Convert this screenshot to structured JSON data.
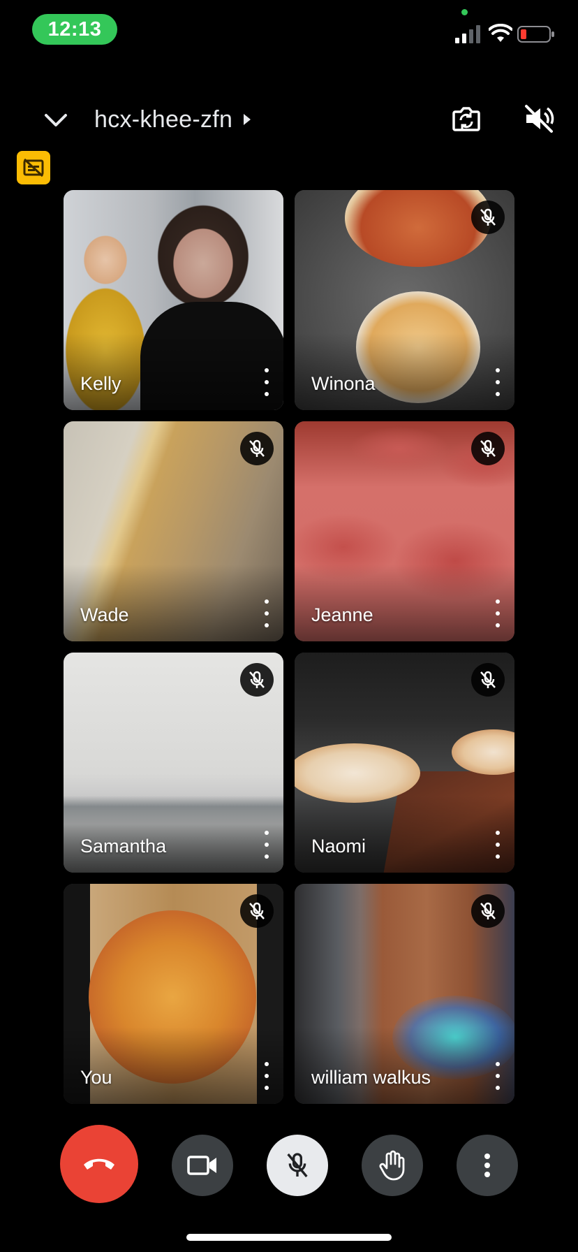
{
  "status_bar": {
    "time": "12:13",
    "icons": [
      "cellular-signal-icon",
      "wifi-icon",
      "battery-low-icon"
    ]
  },
  "header": {
    "meeting_code": "hcx-khee-zfn",
    "icons": [
      "chevron-down-icon",
      "caret-right-icon",
      "flip-camera-icon",
      "speaker-off-icon",
      "captions-off-icon"
    ]
  },
  "participants": [
    {
      "name": "Kelly",
      "muted": false
    },
    {
      "name": "Winona",
      "muted": true
    },
    {
      "name": "Wade",
      "muted": true
    },
    {
      "name": "Jeanne",
      "muted": true
    },
    {
      "name": "Samantha",
      "muted": true
    },
    {
      "name": "Naomi",
      "muted": true
    },
    {
      "name": "You",
      "muted": true
    },
    {
      "name": "william walkus",
      "muted": true
    }
  ],
  "controls": {
    "buttons": [
      "end-call",
      "camera",
      "microphone-muted",
      "raise-hand",
      "more-options"
    ]
  },
  "colors": {
    "background": "#000000",
    "end_call": "#ea4335",
    "caption_badge": "#fbbc04",
    "time_pill": "#34c759",
    "control_dark": "#3c4043",
    "control_light": "#e8eaed"
  }
}
